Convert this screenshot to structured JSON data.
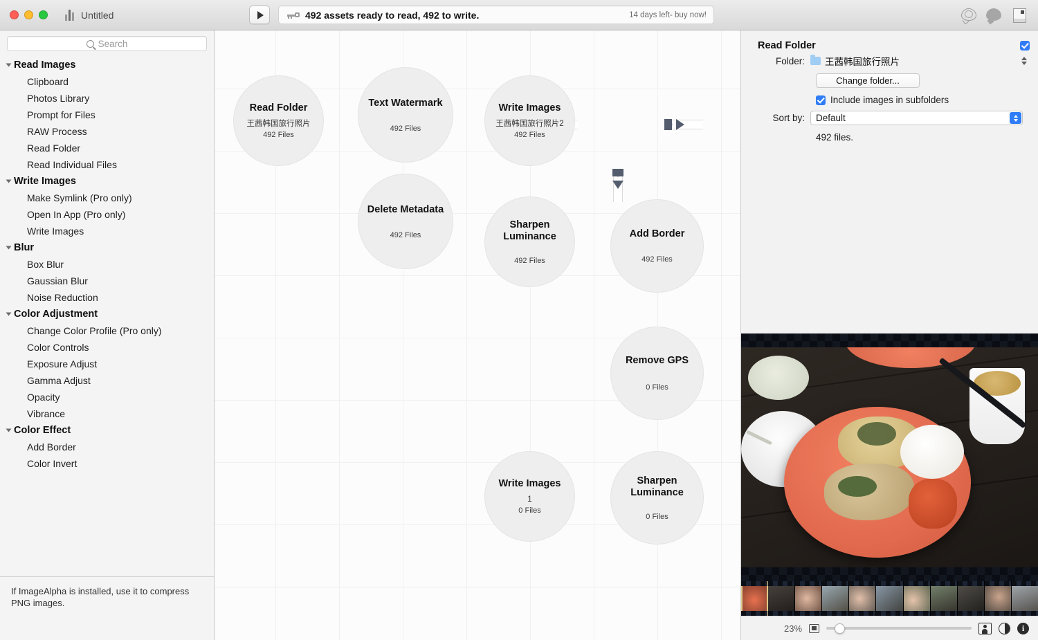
{
  "window": {
    "title": "Untitled",
    "doc_icon": "chart-doc-icon",
    "right_icons": [
      "search-bubble-icon",
      "comment-bubble-icon",
      "inspector-page-icon"
    ]
  },
  "toolbar": {
    "play_label": "play-icon",
    "read_write_icon": "key-icon",
    "status": "492 assets ready to read, 492 to write.",
    "trial": "14 days left- buy now!"
  },
  "sidebar": {
    "search": {
      "placeholder": "Search"
    },
    "groups": [
      {
        "label": "Read Images",
        "items": [
          "Clipboard",
          "Photos Library",
          "Prompt for Files",
          "RAW Process",
          "Read Folder",
          "Read Individual Files"
        ]
      },
      {
        "label": "Write Images",
        "items": [
          "Make Symlink (Pro only)",
          "Open In App (Pro only)",
          "Write Images"
        ]
      },
      {
        "label": "Blur",
        "items": [
          "Box Blur",
          "Gaussian Blur",
          "Noise Reduction"
        ]
      },
      {
        "label": "Color Adjustment",
        "items": [
          "Change Color Profile (Pro only)",
          "Color Controls",
          "Exposure Adjust",
          "Gamma Adjust",
          "Opacity",
          "Vibrance"
        ]
      },
      {
        "label": "Color Effect",
        "items": [
          "Add Border",
          "Color Invert"
        ]
      }
    ],
    "footer_note": "If ImageAlpha is installed, use it to compress PNG images."
  },
  "canvas": {
    "nodes": [
      {
        "title": "Read Folder",
        "sub": "王茜韩国旅行照片",
        "count": "492 Files"
      },
      {
        "title": "Text Watermark",
        "sub": "",
        "count": "492 Files"
      },
      {
        "title": "Write Images",
        "sub": "王茜韩国旅行照片2",
        "count": "492 Files"
      },
      {
        "title": "Delete Metadata",
        "sub": "",
        "count": "492 Files"
      },
      {
        "title": "Sharpen Luminance",
        "sub": "",
        "count": "492 Files"
      },
      {
        "title": "Add Border",
        "sub": "",
        "count": "492 Files"
      },
      {
        "title": "Remove GPS",
        "sub": "",
        "count": "0 Files"
      },
      {
        "title": "Write Images",
        "sub": "1",
        "count": "0 Files"
      },
      {
        "title": "Sharpen Luminance",
        "sub": "",
        "count": "0 Files"
      }
    ],
    "connector_color": "#545d6e"
  },
  "inspector": {
    "title": "Read Folder",
    "enabled": true,
    "folder_label": "Folder:",
    "folder_value": "王茜韩国旅行照片",
    "change_folder_label": "Change folder...",
    "include_subfolders_label": "Include images in subfolders",
    "include_subfolders_checked": true,
    "sort_label": "Sort by:",
    "sort_value": "Default",
    "files_summary": "492 files.",
    "accent_color": "#2f7cf6"
  },
  "preview": {
    "zoom": "23%",
    "icons": [
      "fit-icon",
      "portrait-icon",
      "contrast-icon",
      "info-icon"
    ],
    "info_glyph": "i"
  }
}
